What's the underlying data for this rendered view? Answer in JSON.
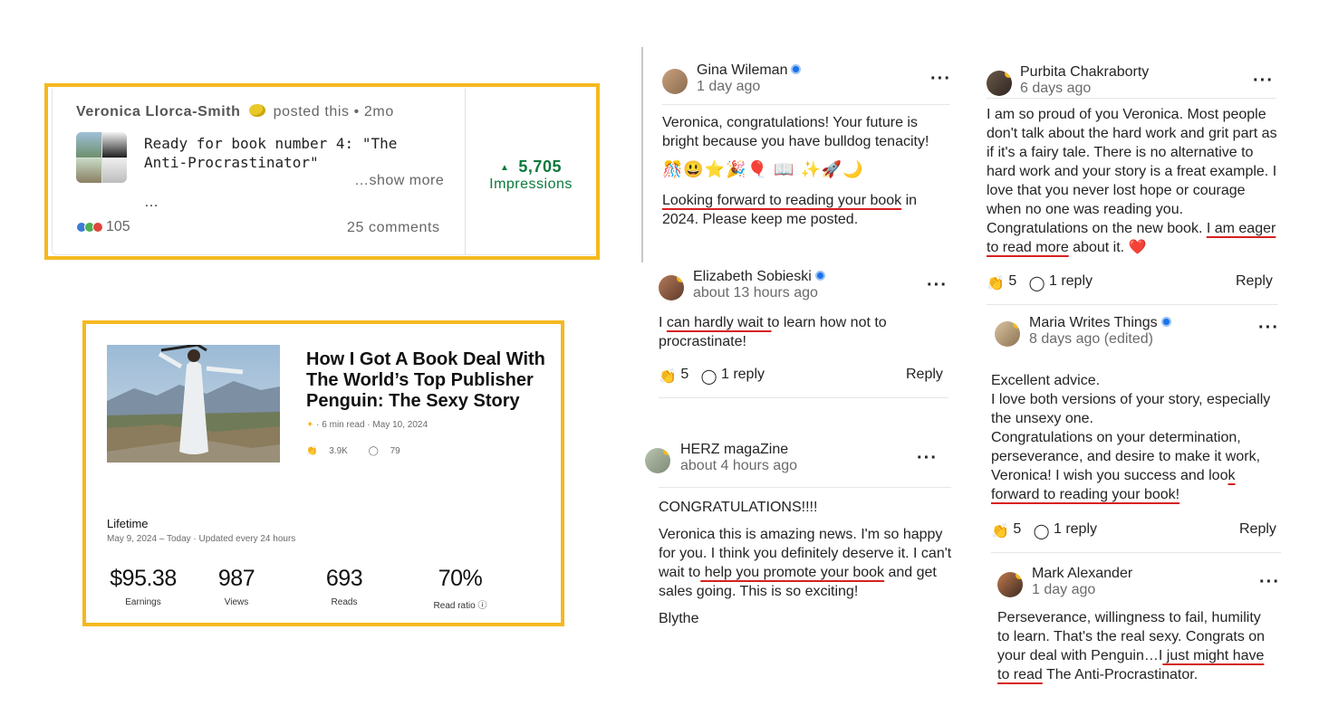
{
  "linkedin": {
    "author": "Veronica Llorca-Smith",
    "action": "posted this",
    "separator": "•",
    "age": "2mo",
    "post_text": "Ready for book number 4: \"The Anti-Procrastinator\"",
    "ellipsis": "…",
    "show_more": "…show more",
    "reaction_count": "105",
    "comments": "25 comments",
    "impressions_value": "5,705",
    "impressions_label": "Impressions",
    "impressions_arrow": "▲",
    "accent_color": "#0b7a3c"
  },
  "medium": {
    "title": "How I Got A Book Deal With The World’s Top Publisher Penguin: The Sexy Story (And…",
    "read_time": "6 min read",
    "date": "May 10, 2024",
    "claps": "3.9K",
    "responses": "79",
    "period_label": "Lifetime",
    "period_range": "May 9, 2024 – Today",
    "updated": "Updated every 24 hours",
    "stats": [
      {
        "value": "$95.38",
        "label": "Earnings"
      },
      {
        "value": "987",
        "label": "Views"
      },
      {
        "value": "693",
        "label": "Reads"
      },
      {
        "value": "70%",
        "label": "Read ratio ⓘ"
      }
    ],
    "frame_color": "#f5b820"
  },
  "comments": {
    "gina": {
      "name": "Gina Wileman",
      "time": "1 day ago",
      "more": "···",
      "p1": "Veronica, congratulations! Your future is bright because you have bulldog tenacity!",
      "emojis": "🎊😃⭐🎉🎈 📖 ✨🚀🌙",
      "p3_underlined": "Looking forward to reading your book",
      "p3_rest": " in 2024. Please keep me posted."
    },
    "elizabeth": {
      "name": "Elizabeth Sobieski",
      "time": "about 13 hours ago",
      "more": "···",
      "pre": "I ",
      "underlined": "can hardly wait t",
      "post": "o learn how not to procrastinate!",
      "claps": "5",
      "replies": "1 reply",
      "reply_label": "Reply"
    },
    "herz": {
      "name": "HERZ magaZine",
      "time": "about 4 hours ago",
      "more": "···",
      "p1": "CONGRATULATIONS!!!!",
      "p2_pre": "Veronica this is amazing news. I'm so happy for you. I think you definitely deserve it. I can't wait to",
      "p2_underlined": " help you promote your book",
      "p2_post": " and get sales going. This is so exciting!",
      "signature": "Blythe"
    },
    "purbita": {
      "name": "Purbita Chakraborty",
      "time": "6 days ago",
      "more": "···",
      "pre": "I am so proud of you Veronica. Most people don't talk about the hard work and grit part as if it's a fairy tale. There is no alternative to hard work and your story is a freat example. I love that you never lost hope or courage when no one was reading you. Congratulations on the new book. ",
      "underlined": "I am eager to read more",
      "post": " about it. ❤️",
      "claps": "5",
      "replies": "1 reply",
      "reply_label": "Reply"
    },
    "maria": {
      "name": "Maria Writes Things",
      "time": "8 days ago (edited)",
      "more": "···",
      "p1": "Excellent advice.",
      "p2": "I love both versions of your story, especially the unsexy one.",
      "p3_pre": "Congratulations on your determination, perseverance, and desire to make it work, Veronica! I wish you success and loo",
      "p3_underlined": "k forward to reading your book!",
      "claps": "5",
      "replies": "1 reply",
      "reply_label": "Reply"
    },
    "mark": {
      "name": "Mark Alexander",
      "time": "1 day ago",
      "more": "···",
      "pre": "Perseverance, willingness to fail, humility to learn. That's the real sexy. Congrats on your deal with Penguin…I",
      "underlined": " just might have to read",
      "post": " The Anti-Procrastinator."
    }
  },
  "underline_color": "#d62020"
}
